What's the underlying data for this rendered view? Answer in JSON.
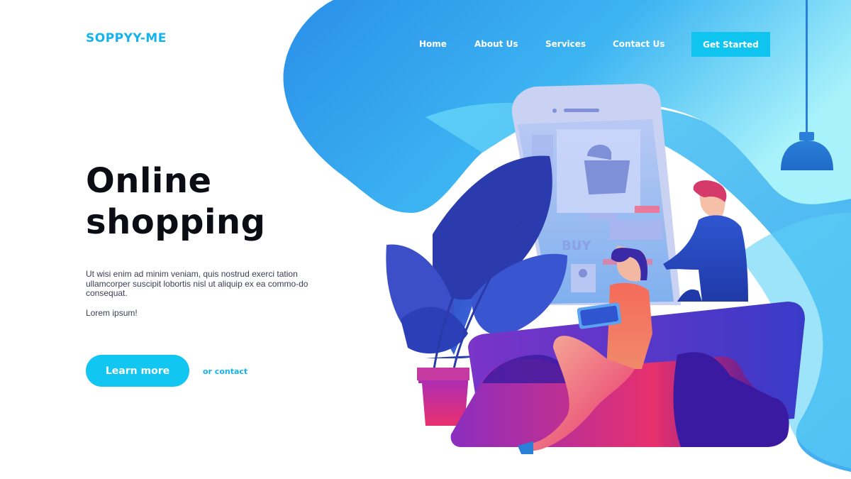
{
  "brand": {
    "name": "SOPPYY-ME"
  },
  "nav": {
    "items": [
      {
        "label": "Home"
      },
      {
        "label": "About Us"
      },
      {
        "label": "Services"
      },
      {
        "label": "Contact Us"
      }
    ],
    "cta_label": "Get Started"
  },
  "hero": {
    "title_line1": "Online",
    "title_line2": "shopping",
    "body": "Ut wisi enim ad minim veniam, quis nostrud exerci tation ullamcorper suscipit lobortis nisl ut aliquip ex ea commo-do consequat.",
    "sub": "Lorem ipsum!",
    "primary_button": "Learn more",
    "secondary_link": "or contact"
  },
  "illustration": {
    "phone_label": "BUY"
  },
  "colors": {
    "accent": "#12c6f2",
    "blob_blue": "#2a9cec",
    "sofa_pink": "#e8306e",
    "sofa_purple": "#4a22a8",
    "title_dark": "#0c0c14"
  }
}
